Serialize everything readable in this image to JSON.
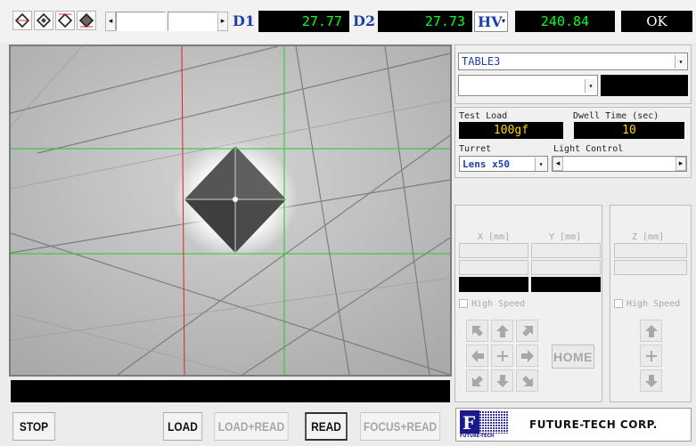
{
  "toolbar": {
    "d1_label": "D1",
    "d1_value": "27.77",
    "d2_label": "D2",
    "d2_value": "27.73",
    "hardness_scale": "HV",
    "hardness_value": "240.84",
    "status": "OK"
  },
  "settings": {
    "table_select": "TABLE3",
    "secondary_select": "",
    "test_load_label": "Test Load",
    "test_load_value": "100gf",
    "dwell_label": "Dwell Time (sec)",
    "dwell_value": "10",
    "turret_label": "Turret",
    "turret_value": "Lens x50",
    "light_label": "Light Control"
  },
  "stage": {
    "x_label": "X [mm]",
    "y_label": "Y [mm]",
    "z_label": "Z [mm]",
    "high_speed_xy": "High Speed",
    "high_speed_z": "High Speed",
    "home_label": "HOME"
  },
  "bottom": {
    "stop": "STOP",
    "load": "LOAD",
    "load_read": "LOAD+READ",
    "read": "READ",
    "focus_read": "FOCUS+READ",
    "logo_small": "FUTURE-TECH",
    "company": "FUTURE-TECH CORP."
  },
  "colors": {
    "lcd_green": "#00ff2a",
    "lcd_yellow": "#ffd400",
    "label_blue": "#1f3fa8",
    "crosshair_green": "#22cc22",
    "crosshair_red": "#dd2222"
  }
}
